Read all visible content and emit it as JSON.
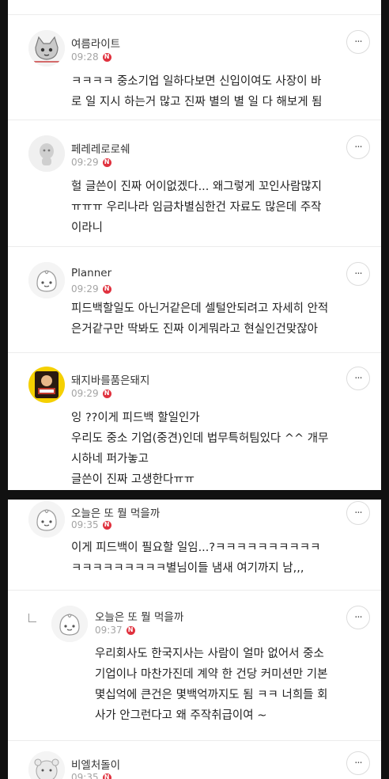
{
  "comments_top": [
    {
      "author": "여름라이트",
      "time": "09:28",
      "new_badge": "N",
      "text": "ㅋㅋㅋㅋ 중소기업 일하다보면 신입이여도 사장이 바\n로 일 지시 하는거 많고 진짜 별의 별 일 다 해보게 됨",
      "avatar_icon": "cat-doodle-avatar-icon"
    },
    {
      "author": "페레레로로쉐",
      "time": "09:29",
      "new_badge": "N",
      "text": "헐 글쓴이 진짜 어이없겠다... 왜그렇게 꼬인사람많지\nㅠㅠㅠ 우리나라 임금차별심한건 자료도 많은데 주작\n이라니",
      "avatar_icon": "default-character-avatar-icon"
    },
    {
      "author": "Planner",
      "time": "09:29",
      "new_badge": "N",
      "text": "피드백할일도 아닌거같은데 셀털안되려고 자세히 안적\n은거같구만 딱봐도 진짜 이게뭐라고 현실인건맞잖아",
      "avatar_icon": "apeach-avatar-icon"
    },
    {
      "author": "돼지바를품은돼지",
      "time": "09:29",
      "new_badge": "N",
      "text": "잉 ??이게 피드백 할일인가\n우리도 중소 기업(중견)인데 법무특허팀있다 ^^ 개무\n시하네 퍼가놓고\n글쓴이 진짜 고생한다ㅠㅠ",
      "avatar_icon": "photo-avatar-icon"
    }
  ],
  "comments_bottom": [
    {
      "author": "오늘은 또 뭘 먹을까",
      "time": "09:35",
      "new_badge": "N",
      "text": "이게 피드백이 필요할 일임...?ㅋㅋㅋㅋㅋㅋㅋㅋㅋㅋ\nㅋㅋㅋㅋㅋㅋㅋㅋㅋ별님이들 냄새 여기까지 남,,,",
      "avatar_icon": "apeach-avatar-icon"
    },
    {
      "author": "오늘은 또 뭘 먹을까",
      "time": "09:37",
      "new_badge": "N",
      "text": "우리회사도 한국지사는 사람이 얼마 없어서 중소\n기업이나 마찬가진데 계약 한 건당 커미션만 기본\n몇십억에 큰건은 몇백억까지도 됨 ㅋㅋ 너희들 회\n사가 안그런다고 왜 주작취급이여 ~",
      "avatar_icon": "apeach-avatar-icon",
      "is_reply": true
    },
    {
      "author": "비엘처돌이",
      "time": "09:35",
      "new_badge": "N",
      "text": "",
      "avatar_icon": "ryan-avatar-icon"
    }
  ],
  "more_button_label": "···"
}
